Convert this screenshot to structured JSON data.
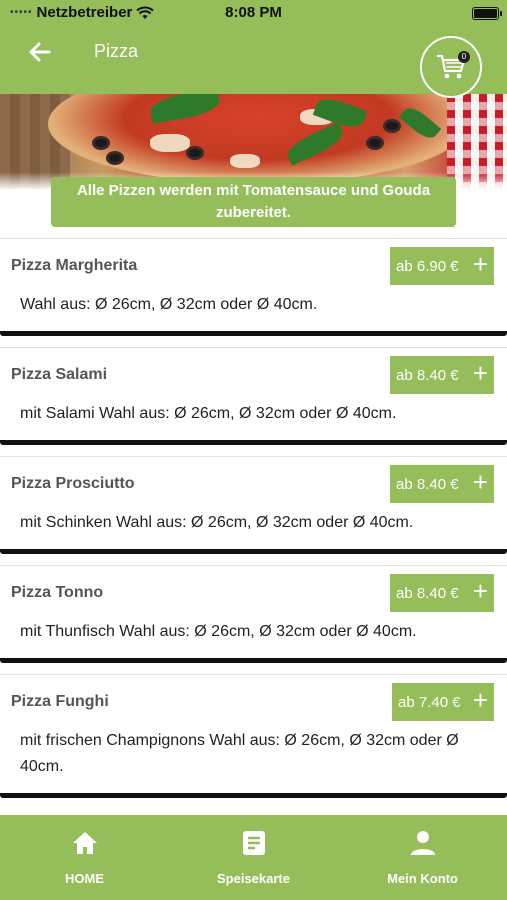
{
  "status_bar": {
    "carrier": "Netzbetreiber",
    "time": "8:08 PM"
  },
  "header": {
    "title": "Pizza",
    "back_icon": "arrow-left-icon",
    "cart_icon": "shopping-cart-icon",
    "cart_count": "0"
  },
  "banner": {
    "text": "Alle Pizzen werden mit Tomatensauce und Gouda zubereitet."
  },
  "items": [
    {
      "name": "Pizza Margherita",
      "price": "ab 6.90 €",
      "add": "+",
      "description": "Wahl aus: Ø 26cm, Ø 32cm oder Ø 40cm."
    },
    {
      "name": "Pizza Salami",
      "price": "ab 8.40 €",
      "add": "+",
      "description": "mit Salami Wahl aus: Ø 26cm, Ø 32cm oder Ø 40cm."
    },
    {
      "name": "Pizza Prosciutto",
      "price": "ab 8.40 €",
      "add": "+",
      "description": "mit Schinken Wahl aus: Ø 26cm, Ø 32cm oder Ø 40cm."
    },
    {
      "name": "Pizza Tonno",
      "price": "ab 8.40 €",
      "add": "+",
      "description": "mit Thunfisch Wahl aus: Ø 26cm, Ø 32cm oder Ø 40cm."
    },
    {
      "name": "Pizza Funghi",
      "price": "ab 7.40 €",
      "add": "+",
      "description": "mit frischen Champignons Wahl aus: Ø 26cm, Ø 32cm oder Ø 40cm."
    }
  ],
  "nav": {
    "home": "HOME",
    "menu": "Speisekarte",
    "account": "Mein Konto"
  },
  "colors": {
    "accent": "#95bd5a",
    "text": "#222222"
  }
}
